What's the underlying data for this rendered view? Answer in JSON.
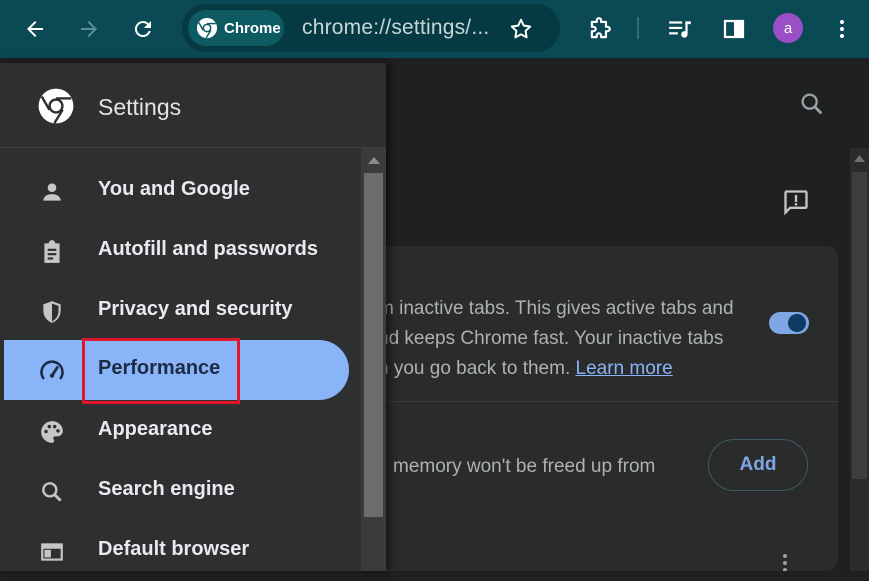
{
  "toolbar": {
    "chip_label": "Chrome",
    "url": "chrome://settings/...",
    "avatar_letter": "a"
  },
  "drawer": {
    "title": "Settings",
    "items": [
      {
        "label": "You and Google",
        "icon": "person-icon"
      },
      {
        "label": "Autofill and passwords",
        "icon": "clipboard-icon"
      },
      {
        "label": "Privacy and security",
        "icon": "shield-icon"
      },
      {
        "label": "Performance",
        "icon": "speedometer-icon",
        "active": true
      },
      {
        "label": "Appearance",
        "icon": "palette-icon"
      },
      {
        "label": "Search engine",
        "icon": "search-icon"
      },
      {
        "label": "Default browser",
        "icon": "browser-window-icon"
      }
    ]
  },
  "content": {
    "line1": "m inactive tabs. This gives active tabs and",
    "line2": "nd keeps Chrome fast. Your inactive tabs",
    "line3": "n you go back to them.",
    "learn_more": "Learn more",
    "memory_text": "memory won't be freed up from",
    "add_label": "Add"
  },
  "colors": {
    "toolbar": "#0b4a54",
    "active_item": "#8ab4f8",
    "highlight_box": "#e0162b"
  }
}
